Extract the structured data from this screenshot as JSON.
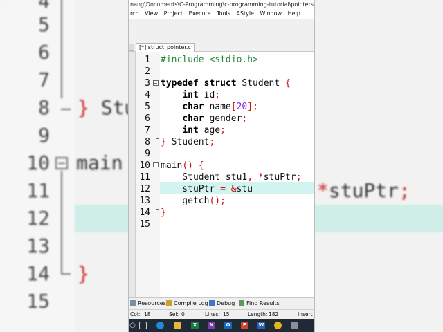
{
  "window": {
    "title_path": "nang\\Documents\\C-Programming\\c-programming-tutorial\\pointers\\struct_pointe"
  },
  "menu": [
    {
      "label": "rch"
    },
    {
      "label": "View"
    },
    {
      "label": "Project"
    },
    {
      "label": "Execute"
    },
    {
      "label": "Tools"
    },
    {
      "label": "AStyle"
    },
    {
      "label": "Window"
    },
    {
      "label": "Help"
    }
  ],
  "tab": {
    "label": "[*] struct_pointer.c"
  },
  "editor": {
    "line_numbers": [
      "1",
      "2",
      "3",
      "4",
      "5",
      "6",
      "7",
      "8",
      "9",
      "10",
      "11",
      "12",
      "13",
      "14",
      "15"
    ],
    "current_line": 12
  },
  "background_zoom": {
    "line_numbers": [
      "4",
      "5",
      "6",
      "7",
      "8",
      "9",
      "10",
      "11",
      "12",
      "13",
      "14",
      "15"
    ],
    "code_line_8": "} Stu",
    "code_line_10": "main",
    "code_line_11_right": "*stuPtr;",
    "code_line_14": "}"
  },
  "bottom_tabs": [
    {
      "label": "Resources",
      "icon": "resources-icon"
    },
    {
      "label": "Compile Log",
      "icon": "compile-log-icon"
    },
    {
      "label": "Debug",
      "icon": "debug-icon"
    },
    {
      "label": "Find Results",
      "icon": "find-results-icon"
    }
  ],
  "status": {
    "col_label": "Col:",
    "col_value": "18",
    "sel_label": "Sel:",
    "sel_value": "0",
    "lines_label": "Lines:",
    "lines_value": "15",
    "length_label": "Length:",
    "length_value": "182",
    "mode": "Insert"
  },
  "taskbar": {
    "icons": [
      "search-icon",
      "task-view-icon",
      "edge-icon",
      "file-explorer-icon",
      "excel-icon",
      "onenote-icon",
      "outlook-icon",
      "powerpoint-icon",
      "word-icon",
      "chrome-icon",
      "devcpp-icon"
    ]
  },
  "colors": {
    "highlight_line": "#d2f4f0",
    "keyword": "#000000",
    "preprocessor": "#2a8a3a",
    "punctuation": "#cc1010",
    "number": "#8a2be2"
  }
}
